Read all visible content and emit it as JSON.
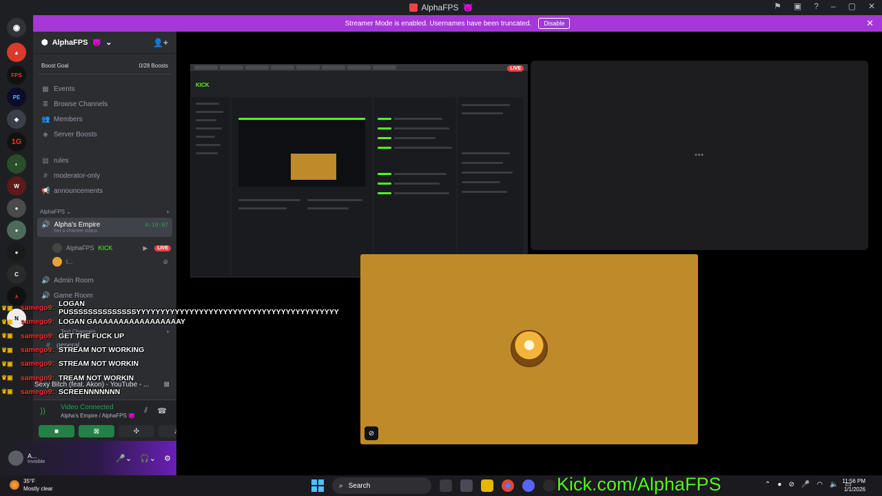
{
  "window": {
    "title": "AlphaFPS",
    "title_emoji": "😈"
  },
  "banner": {
    "text": "Streamer Mode is enabled. Usernames have been truncated.",
    "disable_label": "Disable",
    "close_icon": "close-icon",
    "color": "#a537d8"
  },
  "server": {
    "name": "AlphaFPS",
    "name_emoji": "😈",
    "boost_goal_label": "Boost Goal",
    "boost_progress": "0/28 Boosts"
  },
  "nav": {
    "events": "Events",
    "browse_channels": "Browse Channels",
    "members": "Members",
    "server_boosts": "Server Boosts"
  },
  "channels_top": {
    "rules": "rules",
    "moderator_only": "moderator-only",
    "announcements": "announcements"
  },
  "category": {
    "name": "AlphaFPS"
  },
  "voice_channel": {
    "name": "Alpha's Empire",
    "timer": "4:10:07",
    "status": "Set a channel status"
  },
  "voice_users": [
    {
      "name": "AlphaFPS",
      "badge": "KICK",
      "live": "LIVE"
    },
    {
      "name": "l..."
    }
  ],
  "channels_lower": {
    "admin_room": "Admin Room",
    "game_room": "Game Room",
    "text_channels": "Text Channels",
    "general": "general"
  },
  "chat_overlay": [
    {
      "user": "samego9:",
      "message": "LOGAN PUSSSSSSSSSSSSSSYYYYYYYYYYYYYYYYYYYYYYYYYYYYYYYYYYYYYYYYYY"
    },
    {
      "user": "samego9:",
      "message": "LOGAN GAAAAAAAAAAAAAAAAAY"
    },
    {
      "user": "samego9:",
      "message": "GET THE FUCK UP"
    },
    {
      "user": "samego9:",
      "message": "STREAM NOT WORKING"
    },
    {
      "user": "samego9:",
      "message": "STREAM NOT WORKIN"
    },
    {
      "user": "samego9:",
      "message": "TREAM NOT WORKIN"
    },
    {
      "user": "samego9:",
      "message": "SCREENNNNNNN"
    }
  ],
  "music": {
    "now_playing": "Sexy Bitch (feat. Akon) - YouTube - ..."
  },
  "rtc": {
    "status": "Video Connected",
    "location": "Alpha's Empire / AlphaFPS",
    "location_emoji": "😈"
  },
  "user_panel": {
    "name": "A...",
    "status": "Invisible"
  },
  "stage": {
    "screen_live": "LIVE",
    "screen_brand": "KICK",
    "empty_tile_loading": "•••"
  },
  "taskbar": {
    "temperature": "35°F",
    "weather": "Mostly clear",
    "search_placeholder": "Search",
    "promo": "Kick.com/AlphaFPS",
    "time": "11:56 PM",
    "date": "1/1/2026"
  },
  "colors": {
    "discord_bg": "#2b2d31",
    "rail_bg": "#1e1f22",
    "green": "#23a55a",
    "kick_green": "#53fc18",
    "live_red": "#ed4245",
    "cam_bg": "#bf8a29"
  }
}
